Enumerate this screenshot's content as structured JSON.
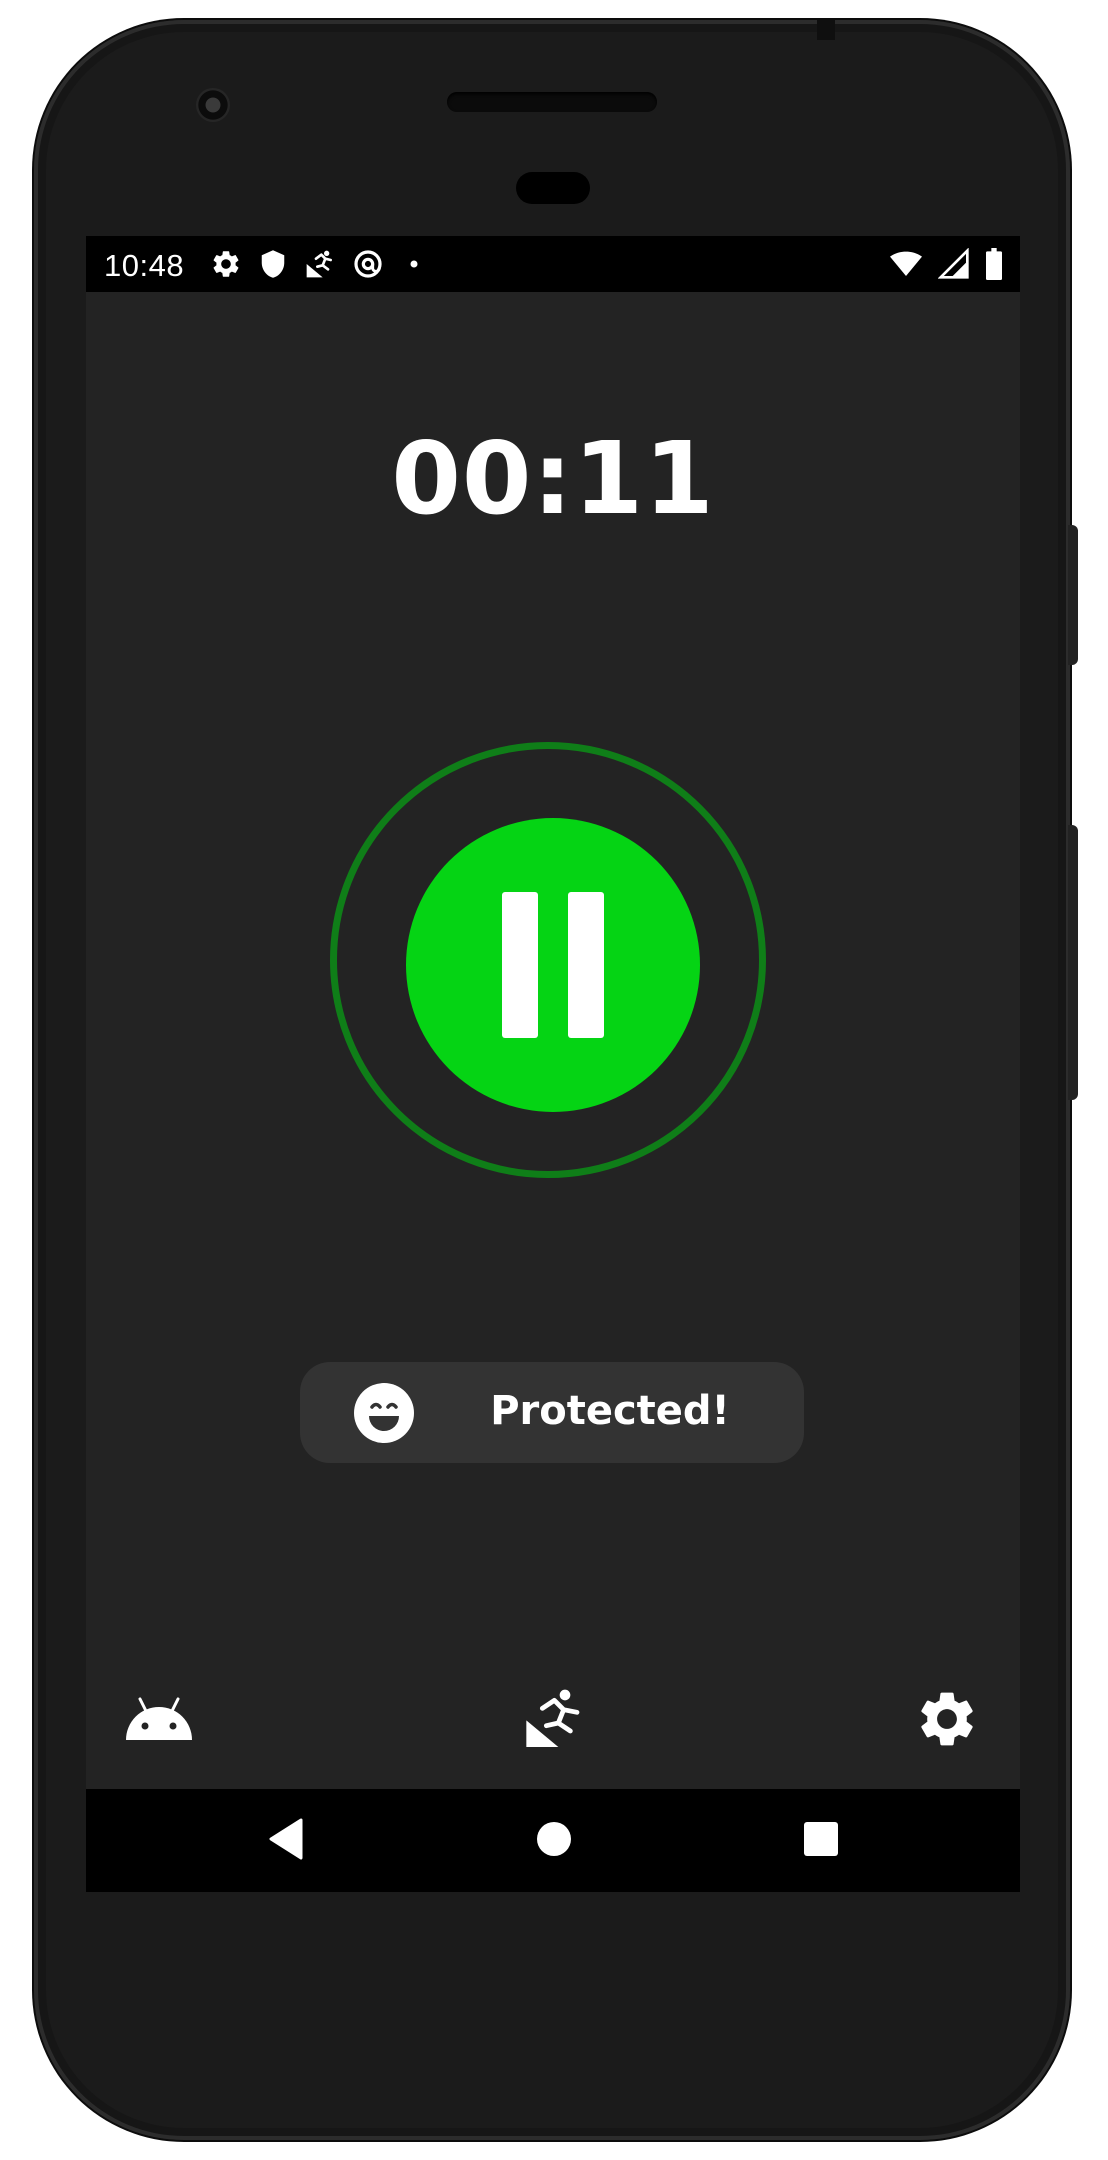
{
  "status_bar": {
    "time": "10:48",
    "left_icons": [
      "settings-icon",
      "shield-icon",
      "fall-detection-icon",
      "at-sign-icon",
      "notification-dot-icon"
    ],
    "right_icons": [
      "wifi-icon",
      "signal-icon",
      "battery-icon"
    ]
  },
  "timer": {
    "elapsed": "00:11"
  },
  "control": {
    "state": "running",
    "icon": "pause-icon",
    "accent_color": "#05d414",
    "ring_color": "#0f7e18"
  },
  "status": {
    "label": "Protected!",
    "icon": "smiley-face-icon"
  },
  "bottom_nav": {
    "items": [
      {
        "icon": "android-icon"
      },
      {
        "icon": "fall-detection-icon"
      },
      {
        "icon": "settings-icon"
      }
    ]
  },
  "system_nav": {
    "buttons": [
      "back-icon",
      "home-icon",
      "recents-icon"
    ]
  },
  "colors": {
    "background": "#232323",
    "pill": "#333333",
    "status_bar": "#000000"
  }
}
